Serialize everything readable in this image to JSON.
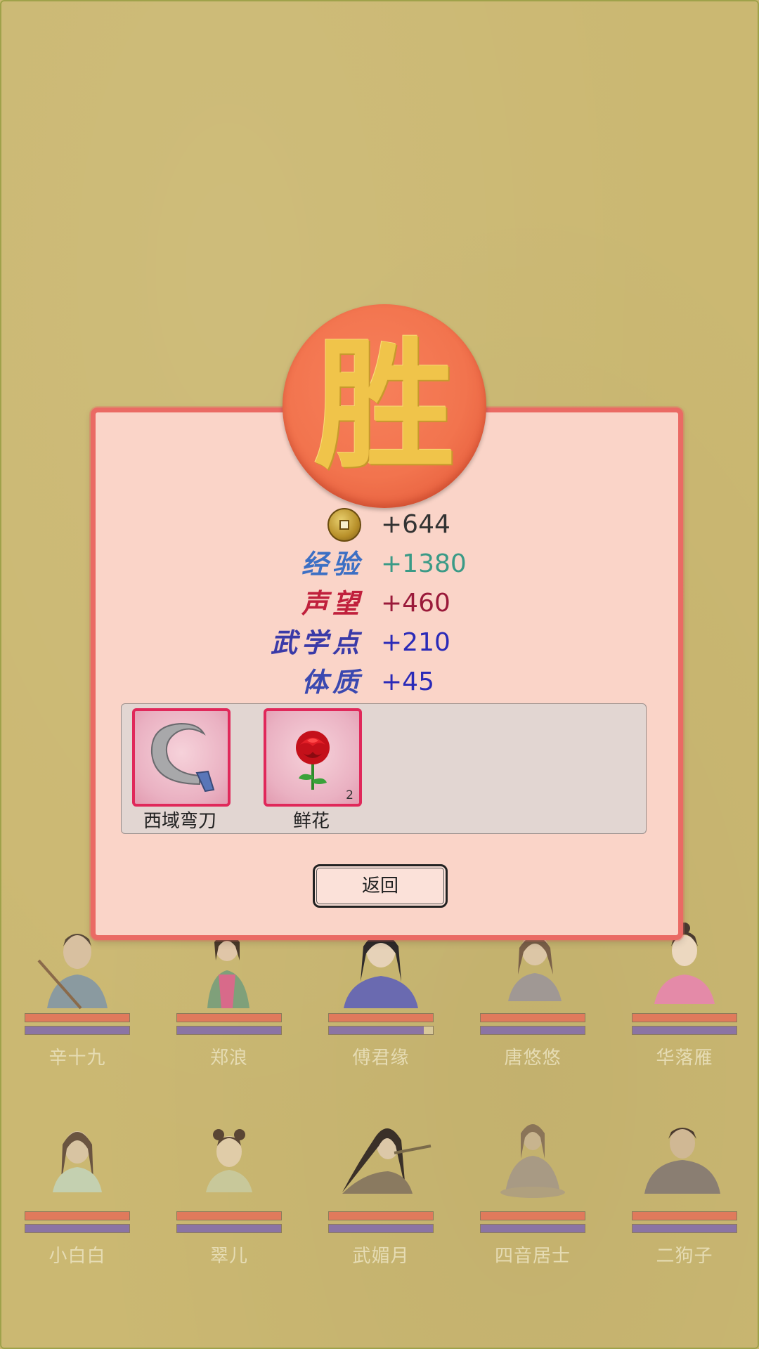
{
  "result": {
    "seal_char": "胜"
  },
  "rewards": [
    {
      "type": "coin",
      "label": "",
      "value": "+644",
      "color": "#333333"
    },
    {
      "type": "exp",
      "label": "经验",
      "value": "+1380",
      "color": "#3a9a86",
      "label_color": "#3c6fc4"
    },
    {
      "type": "reputation",
      "label": "声望",
      "value": "+460",
      "color": "#9a1a3a",
      "label_color": "#c0203c"
    },
    {
      "type": "martial_points",
      "label": "武学点",
      "value": "+210",
      "color": "#2a2ab8",
      "label_color": "#3a3aa8"
    },
    {
      "type": "constitution",
      "label": "体质",
      "value": "+45",
      "color": "#2a2ab8",
      "label_color": "#3a48b0"
    }
  ],
  "items": [
    {
      "name": "西域弯刀",
      "icon": "scimitar-icon",
      "count": ""
    },
    {
      "name": "鲜花",
      "icon": "rose-icon",
      "count": "2"
    }
  ],
  "back_button": {
    "label": "返回"
  },
  "characters": [
    {
      "name": "辛十九",
      "hp": 1.0,
      "mp": 1.0
    },
    {
      "name": "郑浪",
      "hp": 1.0,
      "mp": 1.0
    },
    {
      "name": "傅君缘",
      "hp": 1.0,
      "mp": 0.91
    },
    {
      "name": "唐悠悠",
      "hp": 1.0,
      "mp": 1.0
    },
    {
      "name": "华落雁",
      "hp": 1.0,
      "mp": 1.0
    },
    {
      "name": "小白白",
      "hp": 1.0,
      "mp": 1.0
    },
    {
      "name": "翠儿",
      "hp": 1.0,
      "mp": 1.0
    },
    {
      "name": "武媚月",
      "hp": 1.0,
      "mp": 1.0
    },
    {
      "name": "四音居士",
      "hp": 1.0,
      "mp": 1.0
    },
    {
      "name": "二狗子",
      "hp": 1.0,
      "mp": 1.0
    }
  ]
}
